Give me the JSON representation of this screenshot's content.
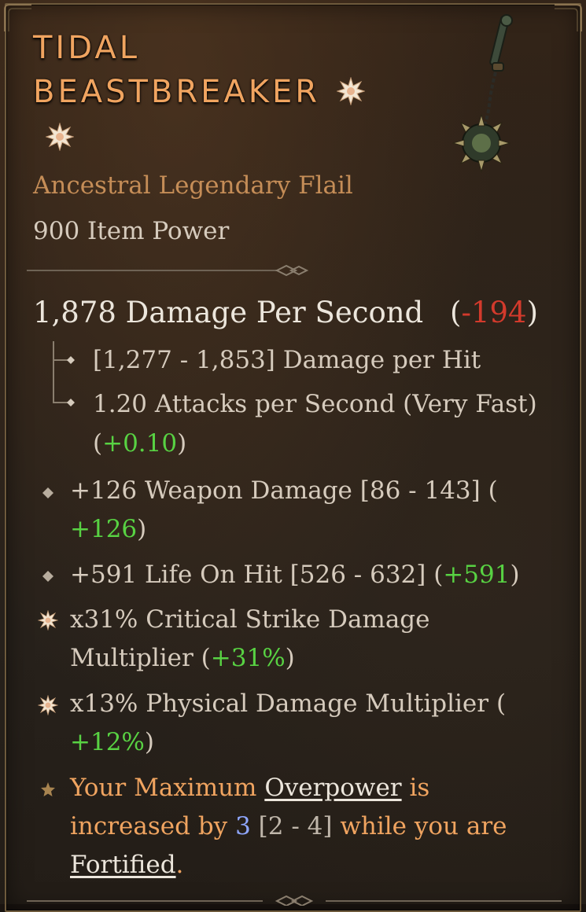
{
  "item": {
    "name_line1": "TIDAL",
    "name_line2": "BEASTBREAKER",
    "type": "Ancestral Legendary Flail",
    "item_power": "900 Item Power",
    "dps_value": "1,878 Damage Per Second",
    "dps_paren_open": "(",
    "dps_delta": "-194",
    "dps_paren_close": ")",
    "damage_per_hit": "[1,277 - 1,853] Damage per Hit",
    "attacks_per_second": "1.20 Attacks per Second (Very Fast)",
    "aps_paren_open": "(",
    "aps_delta": "+0.10",
    "aps_paren_close": ")"
  },
  "affixes": [
    {
      "text": "+126 Weapon Damage [86 - 143] (",
      "delta": "+126",
      "close": ")"
    },
    {
      "text": "+591 Life On Hit [526 - 632] (",
      "delta": "+591",
      "close": ")"
    },
    {
      "text_line1": "x31% Critical Strike Damage",
      "text_line2": "Multiplier (",
      "delta": "+31%",
      "close": ")"
    },
    {
      "text": "x13% Physical Damage Multiplier (",
      "delta": "+12%",
      "close": ")"
    }
  ],
  "aspect": {
    "part1": "Your Maximum ",
    "link1": "Overpower",
    "part2": " is",
    "part3": "increased by ",
    "value": "3",
    "range": " [2 - 4]",
    "part4": " while you are",
    "link2": "Fortified",
    "end": "."
  },
  "colors": {
    "title": "#f0a460",
    "legendary_text": "#c58d57",
    "delta_negative": "#d33a2c",
    "delta_positive": "#58d243",
    "aspect_value": "#8fa7ff"
  },
  "icons": [
    "flail-weapon-icon",
    "socket-star-icon",
    "diamond-bullet-icon",
    "greater-affix-star-icon",
    "legendary-aspect-star-icon"
  ]
}
